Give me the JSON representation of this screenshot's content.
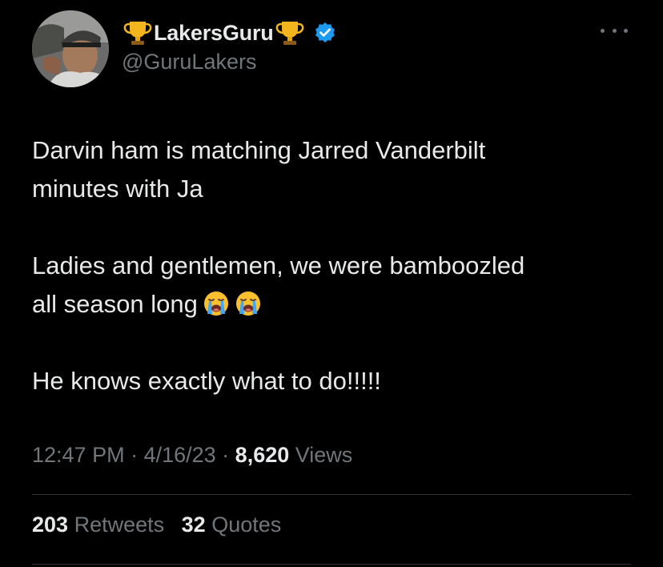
{
  "author": {
    "display_name": "LakersGuru",
    "handle": "@GuruLakers",
    "verified_color": "#1d9bf0"
  },
  "tweet": {
    "line1": "Darvin ham is matching Jarred Vanderbilt",
    "line2": "minutes with Ja",
    "line3": "Ladies and gentlemen, we were bamboozled",
    "line4": "all season long",
    "line5": "He knows exactly what to do!!!!!"
  },
  "meta": {
    "time": "12:47 PM",
    "sep1": " · ",
    "date": "4/16/23",
    "sep2": " · ",
    "views_count": "8,620",
    "views_label": " Views"
  },
  "stats": {
    "retweets_count": "203",
    "retweets_label": "Retweets",
    "quotes_count": "32",
    "quotes_label": "Quotes"
  },
  "icons": {
    "trophy_left": "trophy-icon",
    "trophy_right": "trophy-icon",
    "verified": "verified-badge-icon",
    "emoji": "loudly-crying-face-icon",
    "more": "more-options-icon"
  }
}
